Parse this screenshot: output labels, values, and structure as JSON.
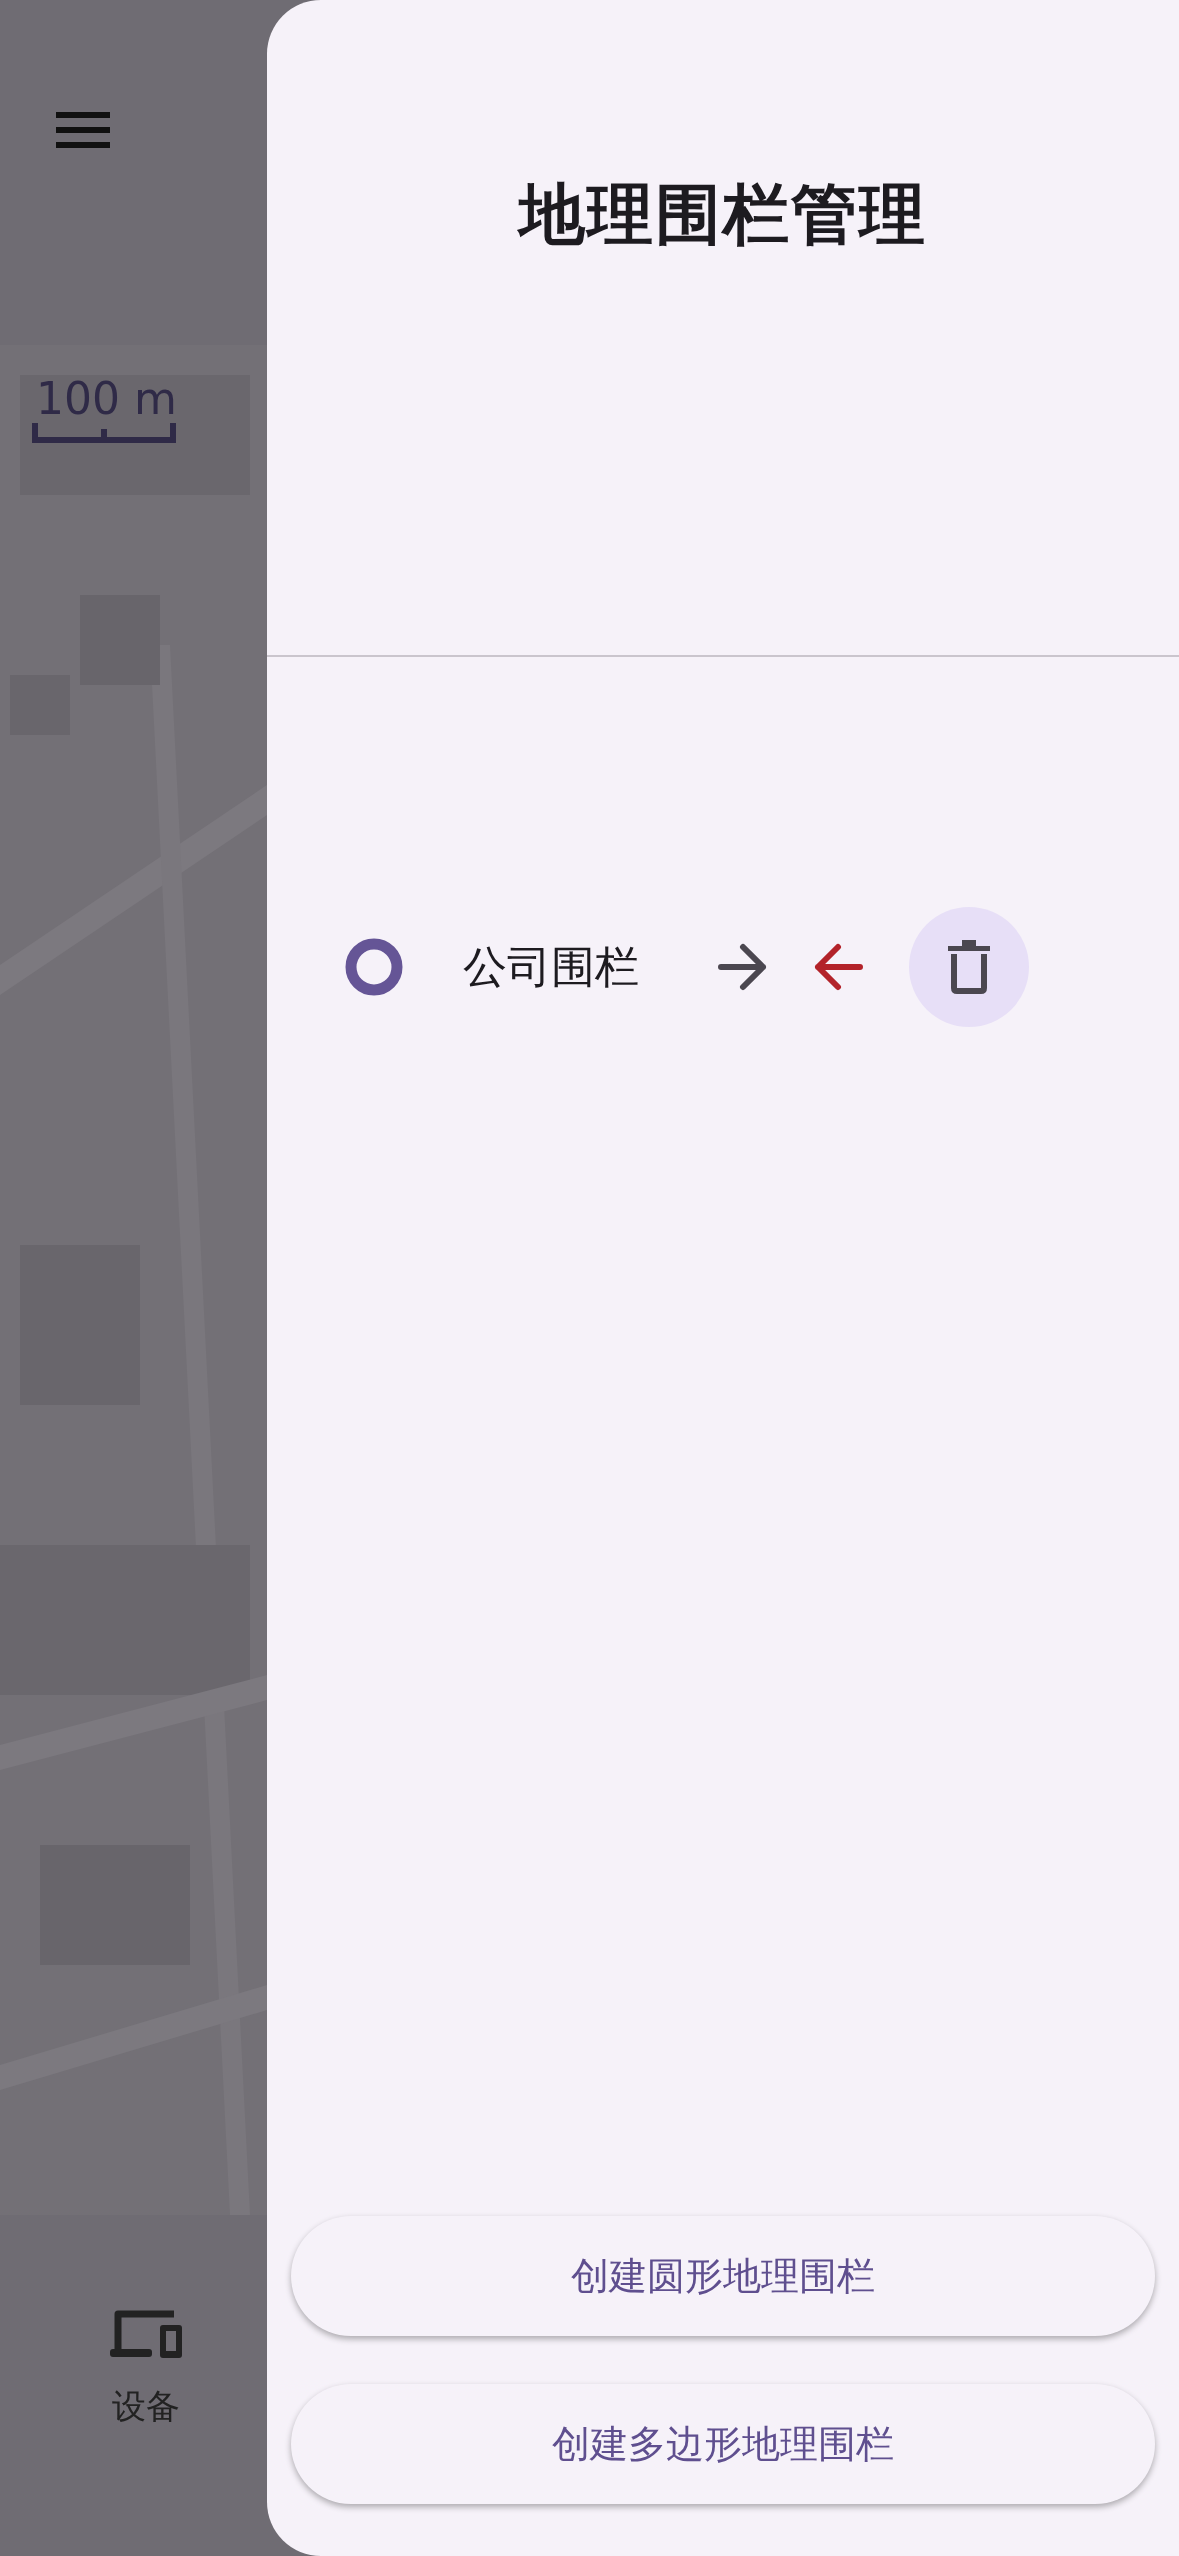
{
  "map": {
    "scale_label": "100 m"
  },
  "bottom_nav": {
    "items": [
      {
        "label": "设备"
      }
    ]
  },
  "drawer": {
    "title": "地理围栏管理",
    "geofences": [
      {
        "name": "公司围栏",
        "kind": "circle"
      }
    ],
    "buttons": [
      "创建圆形地理围栏",
      "创建多边形地理围栏"
    ]
  }
}
